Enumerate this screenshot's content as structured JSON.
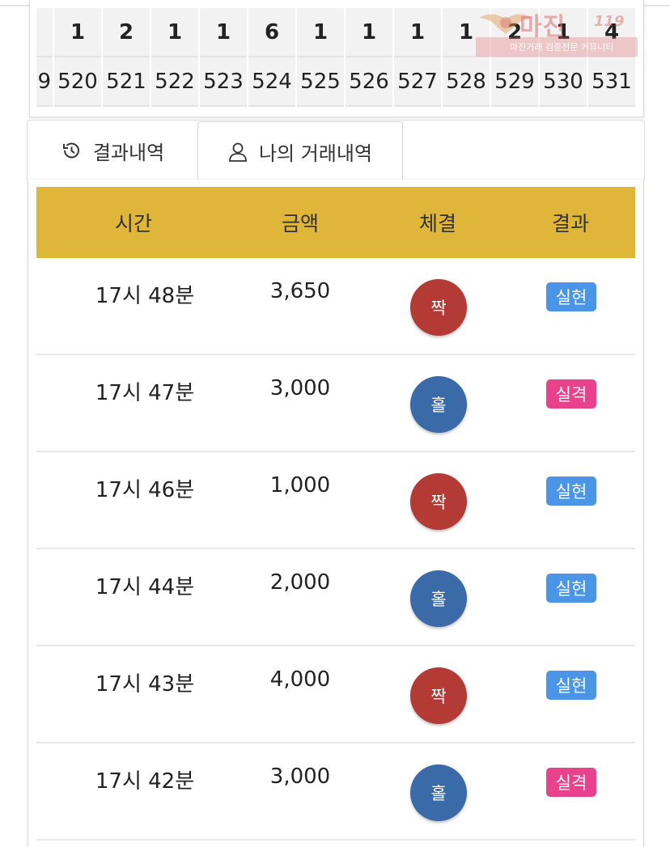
{
  "history": {
    "counts": [
      "",
      "1",
      "2",
      "1",
      "1",
      "6",
      "1",
      "1",
      "1",
      "1",
      "2",
      "1",
      "4"
    ],
    "rounds": [
      "9",
      "520",
      "521",
      "522",
      "523",
      "524",
      "525",
      "526",
      "527",
      "528",
      "529",
      "530",
      "531"
    ]
  },
  "watermark": {
    "title": "마진",
    "tag": "119",
    "subtitle": "마진거래 검증전문 커뮤니티"
  },
  "tabs": {
    "results_label": "결과내역",
    "mine_label": "나의 거래내역"
  },
  "list": {
    "headers": {
      "time": "시간",
      "amount": "금액",
      "fill": "체결",
      "result": "결과"
    },
    "rows": [
      {
        "time": "17시 48분",
        "amount": "3,650",
        "fill": "짝",
        "result": "실현"
      },
      {
        "time": "17시 47분",
        "amount": "3,000",
        "fill": "홀",
        "result": "실격"
      },
      {
        "time": "17시 46분",
        "amount": "1,000",
        "fill": "짝",
        "result": "실현"
      },
      {
        "time": "17시 44분",
        "amount": "2,000",
        "fill": "홀",
        "result": "실현"
      },
      {
        "time": "17시 43분",
        "amount": "4,000",
        "fill": "짝",
        "result": "실현"
      },
      {
        "time": "17시 42분",
        "amount": "3,000",
        "fill": "홀",
        "result": "실격"
      }
    ]
  },
  "colors": {
    "header_bg": "#dfb53a",
    "even_chip": "#b33a35",
    "odd_chip": "#3a6aa8",
    "realized_badge": "#4a95e5",
    "disqualified_badge": "#e8428c"
  }
}
